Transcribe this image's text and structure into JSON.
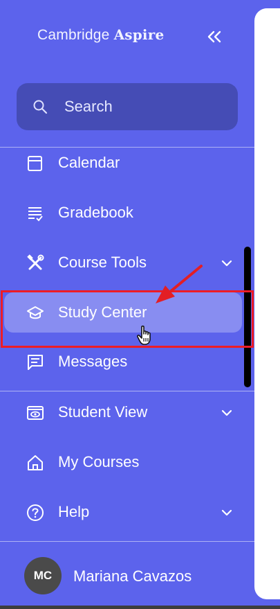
{
  "brand": {
    "name_part1": "Cambridge",
    "name_part2": "Aspire"
  },
  "collapse_icon": "double-chevron-left-icon",
  "search": {
    "placeholder": "Search",
    "icon": "search-icon"
  },
  "nav": {
    "items": [
      {
        "label": "Calendar",
        "icon": "calendar-icon",
        "has_chevron": false
      },
      {
        "label": "Gradebook",
        "icon": "gradebook-icon",
        "has_chevron": false
      },
      {
        "label": "Course Tools",
        "icon": "tools-icon",
        "has_chevron": true
      },
      {
        "label": "Study Center",
        "icon": "graduation-cap-icon",
        "has_chevron": false,
        "active": true
      },
      {
        "label": "Messages",
        "icon": "messages-icon",
        "has_chevron": false
      }
    ],
    "secondary": [
      {
        "label": "Student View",
        "icon": "eye-icon",
        "has_chevron": true
      },
      {
        "label": "My Courses",
        "icon": "home-icon",
        "has_chevron": false
      },
      {
        "label": "Help",
        "icon": "help-icon",
        "has_chevron": true
      }
    ]
  },
  "user": {
    "initials": "MC",
    "name": "Mariana Cavazos"
  },
  "colors": {
    "sidebar_bg": "#5c63ec",
    "search_bg": "#454cb5",
    "highlight_border": "#ee1c25",
    "annotation_arrow": "#e31e24",
    "avatar_bg": "#4a4a4a"
  }
}
